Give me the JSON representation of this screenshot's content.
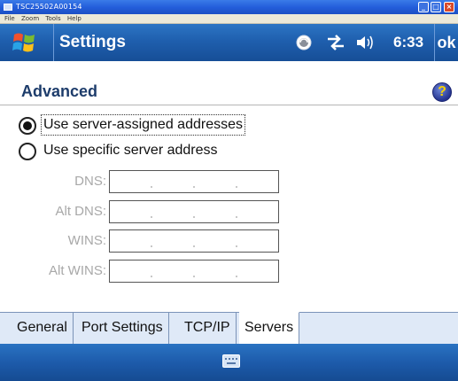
{
  "emulator": {
    "title": "TSC25502A00154",
    "menu": [
      "File",
      "Zoom",
      "Tools",
      "Help"
    ],
    "controls": [
      "minimize-icon",
      "maximize-icon",
      "close-icon"
    ]
  },
  "navbar": {
    "title": "Settings",
    "time": "6:33",
    "ok_label": "ok",
    "status_icons": [
      "connectivity-icon",
      "data-sync-icon",
      "volume-icon"
    ]
  },
  "page": {
    "title": "Advanced",
    "help_icon_text": "?"
  },
  "options": [
    {
      "label": "Use server-assigned addresses",
      "selected": true
    },
    {
      "label": "Use specific server address",
      "selected": false
    }
  ],
  "fields": [
    {
      "label": "DNS:",
      "value": "",
      "enabled": false
    },
    {
      "label": "Alt DNS:",
      "value": "",
      "enabled": false
    },
    {
      "label": "WINS:",
      "value": "",
      "enabled": false
    },
    {
      "label": "Alt WINS:",
      "value": "",
      "enabled": false
    }
  ],
  "tabs": [
    {
      "label": "General",
      "active": false
    },
    {
      "label": "Port Settings",
      "active": false
    },
    {
      "label": "TCP/IP",
      "active": false
    },
    {
      "label": "Servers",
      "active": true
    }
  ],
  "bottom": {
    "input_icon": "keyboard-icon"
  },
  "colors": {
    "bar_blue": "#1f5fae",
    "title_blue": "#1d3c6b",
    "tab_background": "#dfe9f7",
    "disabled_text": "#a8a8a8"
  }
}
